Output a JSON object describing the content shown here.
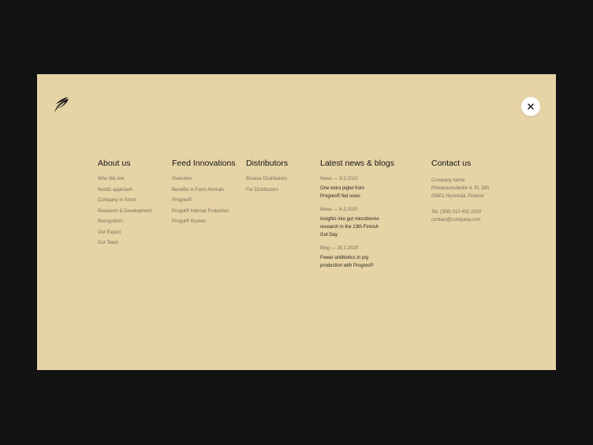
{
  "colors": {
    "backdrop": "#131313",
    "panel": "#e6d3a6",
    "heading": "#151515",
    "link": "#7a6e57"
  },
  "icons": {
    "logo": "leaf-logo-icon",
    "close": "close-icon"
  },
  "about": {
    "heading": "About us",
    "links": [
      "Who We Are",
      "Nordic approach",
      "Company in Short",
      "Research & Development",
      "Recognition",
      "Our Export",
      "Our Team"
    ]
  },
  "feed": {
    "heading": "Feed Innovations",
    "links": [
      "Overview",
      "Benefits in Farm Animals",
      "Progres®",
      "Progut® Internal Protection",
      "Progut® Rumen"
    ]
  },
  "distributors": {
    "heading": "Distributors",
    "links": [
      "Browse Distributors",
      "For Distributors"
    ]
  },
  "news": {
    "heading": "Latest news & blogs",
    "items": [
      {
        "meta": "News — 9.3.2020",
        "title": "One extra piglet from Progres® fed sows"
      },
      {
        "meta": "News — 6.2.2020",
        "title": "Insights into gut microbiome research in the 13th Finnish Gut Day"
      },
      {
        "meta": "Blog — 28.1.2020",
        "title": "Fewer antibiotics in pig production with Progres®"
      }
    ]
  },
  "contact": {
    "heading": "Contact us",
    "company": "Company name",
    "address1": "Pintokuumolantie 4, PL 380",
    "address2": "05801 Hyvinkää, Finland",
    "phone": "Tel. (358) 010 402 2020",
    "email": "contact@company.com"
  }
}
